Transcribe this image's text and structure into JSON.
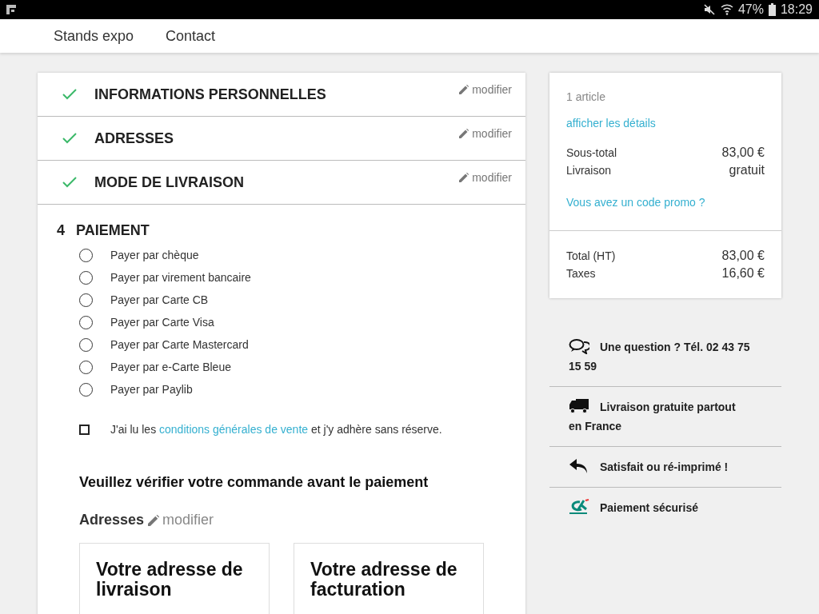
{
  "status_bar": {
    "battery": "47%",
    "time": "18:29"
  },
  "nav": {
    "items": [
      {
        "label": "Stands expo"
      },
      {
        "label": "Contact"
      }
    ]
  },
  "steps": [
    {
      "title": "INFORMATIONS PERSONNELLES",
      "done": true,
      "edit": "modifier"
    },
    {
      "title": "ADRESSES",
      "done": true,
      "edit": "modifier"
    },
    {
      "title": "MODE DE LIVRAISON",
      "done": true,
      "edit": "modifier"
    }
  ],
  "payment": {
    "number": "4",
    "title": "PAIEMENT",
    "options": [
      {
        "label": "Payer par chèque",
        "selected": false
      },
      {
        "label": "Payer par virement bancaire",
        "selected": false
      },
      {
        "label": "Payer par Carte CB",
        "selected": false
      },
      {
        "label": "Payer par Carte Visa",
        "selected": false
      },
      {
        "label": "Payer par Carte Mastercard",
        "selected": false
      },
      {
        "label": "Payer par e-Carte Bleue",
        "selected": false
      },
      {
        "label": "Payer par Paylib",
        "selected": false
      }
    ],
    "terms": {
      "checked": false,
      "before": "J'ai lu les ",
      "link": "conditions générales de vente",
      "after": " et j'y adhère sans réserve."
    },
    "review": {
      "title": "Veuillez vérifier votre commande avant le paiement",
      "addresses_label": "Adresses",
      "edit": "modifier",
      "cards": [
        {
          "title": "Votre adresse de livraison"
        },
        {
          "title": "Votre adresse de facturation"
        }
      ]
    }
  },
  "summary": {
    "count": "1 article",
    "details_link": "afficher les détails",
    "lines": [
      {
        "label": "Sous-total",
        "value": "83,00 €"
      },
      {
        "label": "Livraison",
        "value": "gratuit"
      }
    ],
    "promo_link": "Vous avez un code promo ?",
    "totals": [
      {
        "label": "Total (HT)",
        "value": "83,00 €"
      },
      {
        "label": "Taxes",
        "value": "16,60 €"
      }
    ]
  },
  "reassurance": [
    {
      "kind": "chat",
      "text": "Une question ? Tél. 02 43 75 15 59"
    },
    {
      "kind": "truck",
      "text": "Livraison gratuite partout en France"
    },
    {
      "kind": "return",
      "text": "Satisfait ou ré-imprimé !"
    },
    {
      "kind": "bank",
      "text": "Paiement sécurisé"
    }
  ]
}
